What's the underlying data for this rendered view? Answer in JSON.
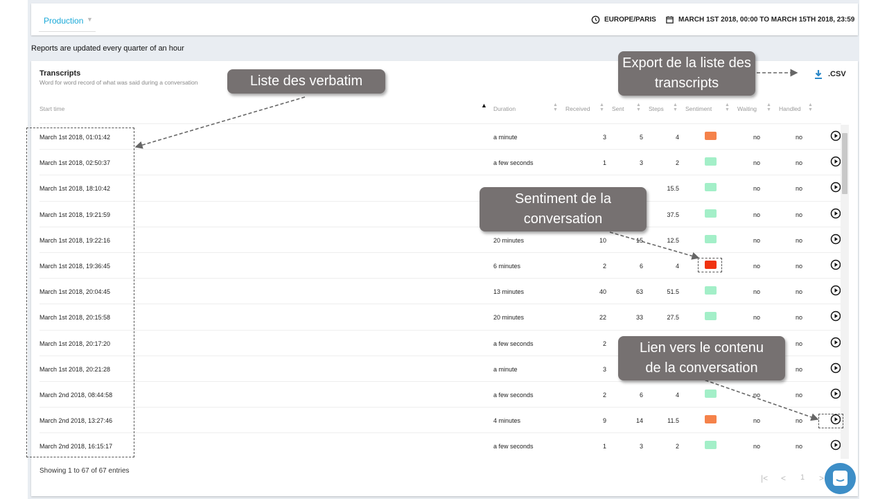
{
  "header": {
    "environment": "Production",
    "timezone": "EUROPE/PARIS",
    "date_range": "MARCH 1ST 2018, 00:00 TO MARCH 15TH 2018, 23:59"
  },
  "notice": "Reports are updated every quarter of an hour",
  "transcripts": {
    "title": "Transcripts",
    "subtitle": "Word for word record of what was said during a conversation",
    "export_label": ".CSV",
    "columns": [
      "Start time",
      "Duration",
      "Received",
      "Sent",
      "Steps",
      "Sentiment",
      "Waiting",
      "Handled"
    ],
    "sort": {
      "column": "Duration",
      "direction": "ascending"
    },
    "sentiment_colors": {
      "positive": "#a3efc8",
      "negative": "#f5824a",
      "very_negative": "#f0320f"
    },
    "rows": [
      {
        "start": "March 1st 2018, 01:01:42",
        "duration": "a minute",
        "received": "3",
        "sent": "5",
        "steps": "4",
        "sentiment": "negative",
        "waiting": "no",
        "handled": "no"
      },
      {
        "start": "March 1st 2018, 02:50:37",
        "duration": "a few seconds",
        "received": "1",
        "sent": "3",
        "steps": "2",
        "sentiment": "positive",
        "waiting": "no",
        "handled": "no"
      },
      {
        "start": "March 1st 2018, 18:10:42",
        "duration": "",
        "received": "",
        "sent": "",
        "steps": "15.5",
        "sentiment": "positive",
        "waiting": "no",
        "handled": "no"
      },
      {
        "start": "March 1st 2018, 19:21:59",
        "duration": "",
        "received": "",
        "sent": "",
        "steps": "37.5",
        "sentiment": "positive",
        "waiting": "no",
        "handled": "no"
      },
      {
        "start": "March 1st 2018, 19:22:16",
        "duration": "20 minutes",
        "received": "10",
        "sent": "15",
        "steps": "12.5",
        "sentiment": "positive",
        "waiting": "no",
        "handled": "no"
      },
      {
        "start": "March 1st 2018, 19:36:45",
        "duration": "6 minutes",
        "received": "2",
        "sent": "6",
        "steps": "4",
        "sentiment": "very_negative",
        "waiting": "no",
        "handled": "no"
      },
      {
        "start": "March 1st 2018, 20:04:45",
        "duration": "13 minutes",
        "received": "40",
        "sent": "63",
        "steps": "51.5",
        "sentiment": "positive",
        "waiting": "no",
        "handled": "no"
      },
      {
        "start": "March 1st 2018, 20:15:58",
        "duration": "20 minutes",
        "received": "22",
        "sent": "33",
        "steps": "27.5",
        "sentiment": "positive",
        "waiting": "no",
        "handled": "no"
      },
      {
        "start": "March 1st 2018, 20:17:20",
        "duration": "a few seconds",
        "received": "2",
        "sent": "",
        "steps": "",
        "sentiment": "",
        "waiting": "",
        "handled": "no"
      },
      {
        "start": "March 1st 2018, 20:21:28",
        "duration": "a minute",
        "received": "3",
        "sent": "",
        "steps": "",
        "sentiment": "",
        "waiting": "",
        "handled": "no"
      },
      {
        "start": "March 2nd 2018, 08:44:58",
        "duration": "a few seconds",
        "received": "2",
        "sent": "6",
        "steps": "4",
        "sentiment": "positive",
        "waiting": "no",
        "handled": "no"
      },
      {
        "start": "March 2nd 2018, 13:27:46",
        "duration": "4 minutes",
        "received": "9",
        "sent": "14",
        "steps": "11.5",
        "sentiment": "negative",
        "waiting": "no",
        "handled": "no"
      },
      {
        "start": "March 2nd 2018, 16:15:17",
        "duration": "a few seconds",
        "received": "1",
        "sent": "3",
        "steps": "2",
        "sentiment": "positive",
        "waiting": "no",
        "handled": "no"
      }
    ],
    "footer": "Showing 1 to 67 of 67 entries",
    "pagination": {
      "current_page": "1"
    }
  },
  "callouts": {
    "verbatim": "Liste des verbatim",
    "export": "Export de la  liste des transcripts",
    "sentiment": "Sentiment de la conversation",
    "link": "Lien vers le contenu de la conversation"
  }
}
